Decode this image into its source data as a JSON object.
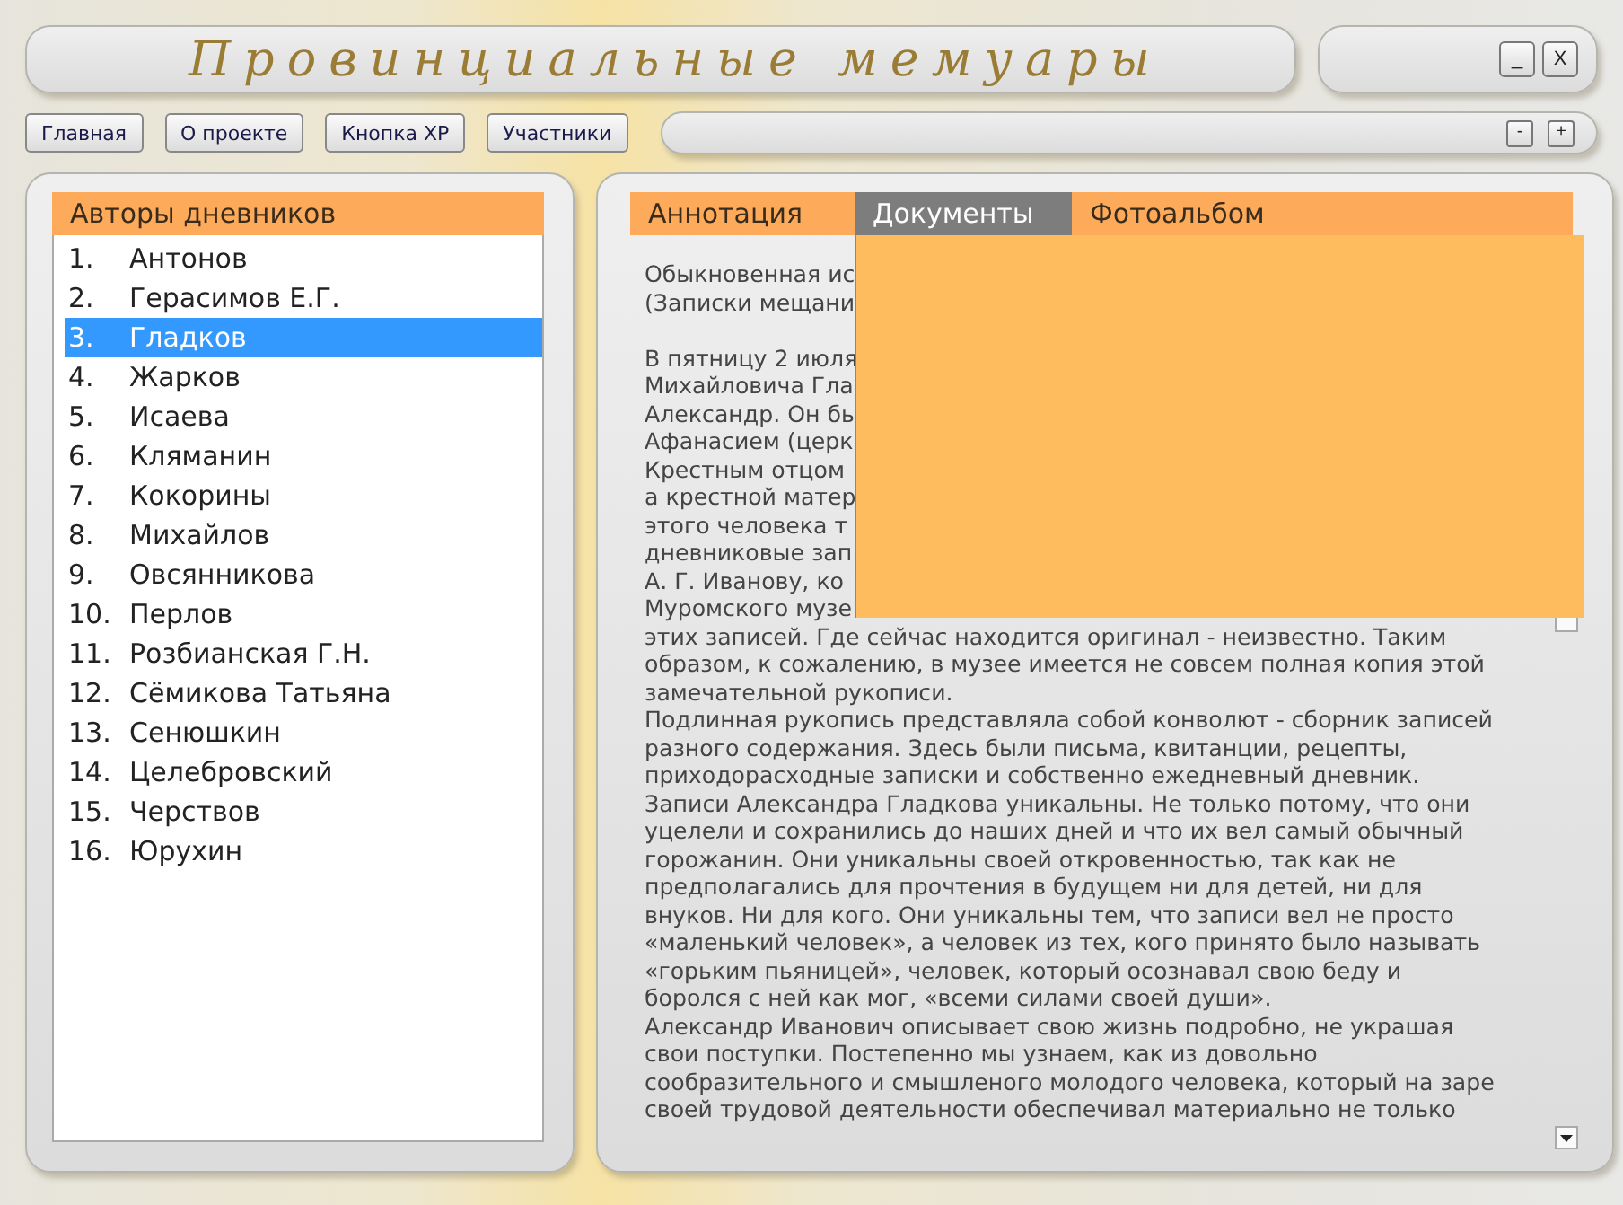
{
  "window": {
    "title": "Провинциальные мемуары",
    "controls": [
      "_",
      "X"
    ]
  },
  "nav_buttons": [
    "Главная",
    "О проекте",
    "Кнопка XP",
    "Участники"
  ],
  "zoom_bar": {
    "buttons": [
      "-",
      "+"
    ]
  },
  "authors": {
    "title": "Авторы дневников",
    "items": [
      {
        "number": "1.",
        "name": "Антонов",
        "selected": false
      },
      {
        "number": "2.",
        "name": "Герасимов Е.Г.",
        "selected": false
      },
      {
        "number": "3.",
        "name": "Гладков",
        "selected": true
      },
      {
        "number": "4.",
        "name": "Жарков",
        "selected": false
      },
      {
        "number": "5.",
        "name": "Исаева",
        "selected": false
      },
      {
        "number": "6.",
        "name": "Кляманин",
        "selected": false
      },
      {
        "number": "7.",
        "name": "Кокорины",
        "selected": false
      },
      {
        "number": "8.",
        "name": "Михайлов",
        "selected": false
      },
      {
        "number": "9.",
        "name": "Овсянникова",
        "selected": false
      },
      {
        "number": "10.",
        "name": "Перлов",
        "selected": false
      },
      {
        "number": "11.",
        "name": "Розбианская Г.Н.",
        "selected": false
      },
      {
        "number": "12.",
        "name": "Сёмикова Татьяна",
        "selected": false
      },
      {
        "number": "13.",
        "name": "Сенюшкин",
        "selected": false
      },
      {
        "number": "14.",
        "name": "Целебровский",
        "selected": false
      },
      {
        "number": "15.",
        "name": "Черствов",
        "selected": false
      },
      {
        "number": "16.",
        "name": "Юрухин",
        "selected": false
      }
    ]
  },
  "tabs": [
    {
      "label": "Аннотация",
      "selected": false
    },
    {
      "label": "Документы",
      "selected": true
    },
    {
      "label": "Фотоальбом",
      "selected": false
    }
  ],
  "document_heading_lines": [
    "Обыкновенная ис",
    "(Записки мещани"
  ],
  "document_lines": [
    "В пятницу 2 июля",
    "Михайловича Гла",
    "Александр. Он бы",
    "Афанасием (церк",
    "Крестным отцом",
    "а крестной матер",
    "этого человека т",
    "дневниковые зап",
    "А. Г. Иванову, ко",
    "Муромского музе",
    "этих записей. Где сейчас находится оригинал - неизвестно. Таким",
    "образом, к сожалению, в музее имеется не совсем полная копия этой",
    "замечательной рукописи.",
    "Подлинная рукопись представляла собой конволют - сборник записей",
    "разного содержания. Здесь были письма, квитанции, рецепты,",
    "приходорасходные записки и собственно ежедневный дневник.",
    "Записи Александра Гладкова уникальны. Не только потому, что они",
    "уцелели и сохранились до наших дней и что их вел самый обычный",
    "горожанин. Они уникальны своей откровенностью, так как не",
    "предполагались для прочтения в будущем ни для детей, ни для",
    "внуков. Ни для кого. Они уникальны тем, что записи вел не просто",
    "«маленький человек», а человек из тех, кого принято было называть",
    "«горьким пьяницей», человек, который осознавал свою беду и",
    "боролся с ней как мог, «всеми силами своей души».",
    "Александр Иванович описывает свою жизнь подробно, не украшая",
    "свои поступки. Постепенно мы узнаем, как из довольно",
    "сообразительного и смышленого молодого человека, который на заре",
    "своей трудовой деятельности обеспечивал материально не только"
  ]
}
